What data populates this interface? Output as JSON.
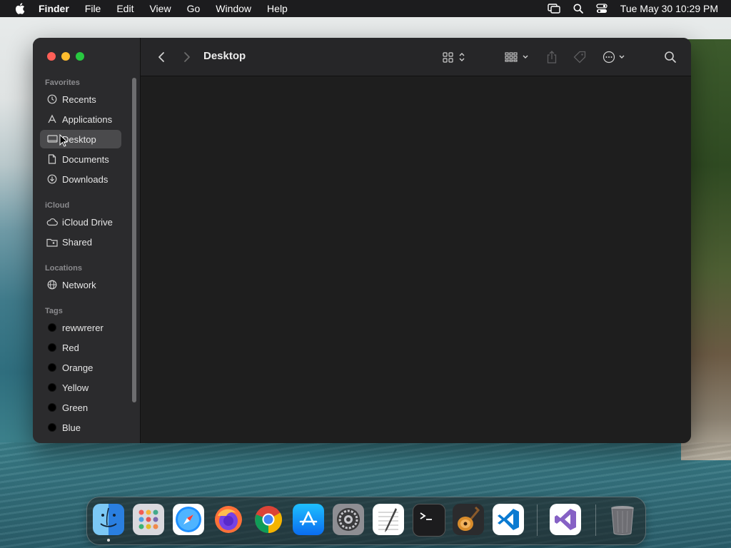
{
  "menubar": {
    "app_name": "Finder",
    "menus": [
      "File",
      "Edit",
      "View",
      "Go",
      "Window",
      "Help"
    ],
    "clock": "Tue May 30  10:29 PM",
    "icons": [
      "screen-mirroring-icon",
      "spotlight-search-icon",
      "control-center-icon"
    ]
  },
  "window": {
    "title": "Desktop",
    "toolbar_icons": [
      "back-icon",
      "forward-icon",
      "icon-view-icon",
      "group-icon",
      "share-icon",
      "tag-icon",
      "more-actions-icon",
      "search-icon"
    ]
  },
  "sidebar": {
    "favorites_title": "Favorites",
    "favorites": [
      {
        "label": "Recents",
        "icon": "clock-icon"
      },
      {
        "label": "Applications",
        "icon": "applications-icon"
      },
      {
        "label": "Desktop",
        "icon": "desktop-icon",
        "selected": true
      },
      {
        "label": "Documents",
        "icon": "document-icon"
      },
      {
        "label": "Downloads",
        "icon": "download-icon"
      }
    ],
    "icloud_title": "iCloud",
    "icloud": [
      {
        "label": "iCloud Drive",
        "icon": "cloud-icon"
      },
      {
        "label": "Shared",
        "icon": "shared-folder-icon"
      }
    ],
    "locations_title": "Locations",
    "locations": [
      {
        "label": "Network",
        "icon": "globe-icon"
      }
    ],
    "tags_title": "Tags",
    "tags": [
      {
        "label": "rewwrerer",
        "color": "#000000"
      },
      {
        "label": "Red",
        "color": "#000000"
      },
      {
        "label": "Orange",
        "color": "#000000"
      },
      {
        "label": "Yellow",
        "color": "#000000"
      },
      {
        "label": "Green",
        "color": "#000000"
      },
      {
        "label": "Blue",
        "color": "#000000"
      }
    ]
  },
  "dock": {
    "apps": [
      "finder-icon",
      "launchpad-icon",
      "safari-icon",
      "firefox-icon",
      "chrome-icon",
      "app-store-icon",
      "system-settings-icon",
      "textedit-icon",
      "terminal-icon",
      "garageband-icon",
      "vscode-icon",
      "visual-studio-icon",
      "trash-icon"
    ]
  },
  "colors": {
    "close": "#ff5f57",
    "minimize": "#febc2e",
    "maximize": "#28c840",
    "sidebar_bg": "#2b2b2d",
    "content_bg": "#1e1e1e"
  }
}
